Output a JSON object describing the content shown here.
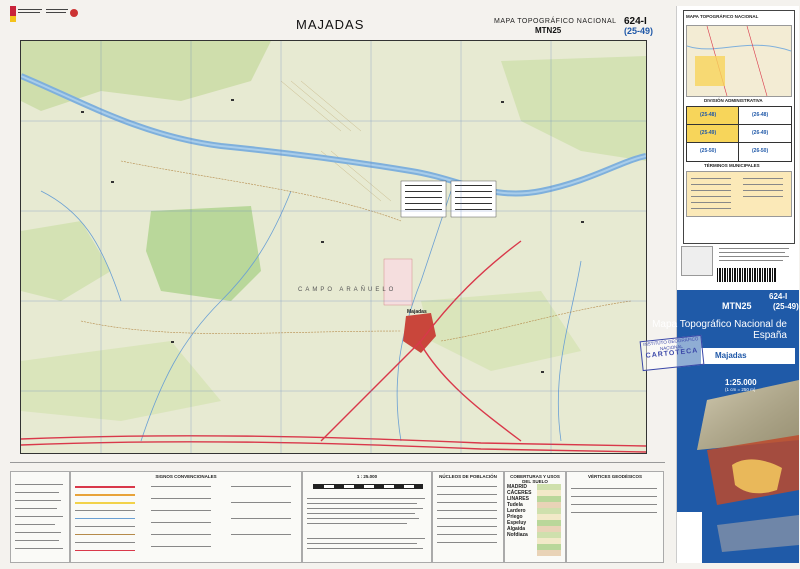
{
  "header": {
    "title": "MAJADAS",
    "series_label": "MAPA TOPOGRÁFICO NACIONAL",
    "series_code": "MTN25",
    "sheet_number": "624-I",
    "sheet_grid": "(25-49)"
  },
  "map": {
    "places": {
      "majadas": "Majadas",
      "campo_arañuelo": "CAMPO ARAÑUELO"
    },
    "colors": {
      "land": "#e7ead2",
      "forest": "#b9d79a",
      "river": "#7fb0dc",
      "road": "#d9384a",
      "urban": "#c9463b"
    }
  },
  "legend": {
    "signos": "SIGNOS CONVENCIONALES",
    "scale": "1 : 25.000",
    "nucleos": "NÚCLEOS DE POBLACIÓN",
    "coberturas": "COBERTURAS Y USOS DEL SUELO",
    "vertices": "VÉRTICES GEODÉSICOS",
    "city_samples": [
      "MADRID",
      "CÁCERES",
      "LINARES",
      "Tudela",
      "Lardero",
      "Priego",
      "Espeluy",
      "Algaida",
      "Nofdiaza"
    ]
  },
  "cover": {
    "top_title": "MAPA TOPOGRÁFICO NACIONAL",
    "division": "DIVISIÓN ADMINISTRATIVA",
    "terminos": "TÉRMINOS MUNICIPALES",
    "grid_cells": [
      "(25-48)",
      "(26-48)",
      "(25-49)",
      "(26-49)",
      "(25-50)",
      "(26-50)"
    ],
    "series_code": "MTN25",
    "sheet_number": "624-I",
    "sheet_grid": "(25-49)",
    "title": "Mapa Topográfico Nacional de España",
    "sheet_name": "Majadas",
    "scale": "1:25.000",
    "scale_note": "(1 cm = 250 m)",
    "stamp": [
      "INSTITUTO GEOGRÁFICO",
      "NACIONAL",
      "CARTOTECA"
    ]
  }
}
